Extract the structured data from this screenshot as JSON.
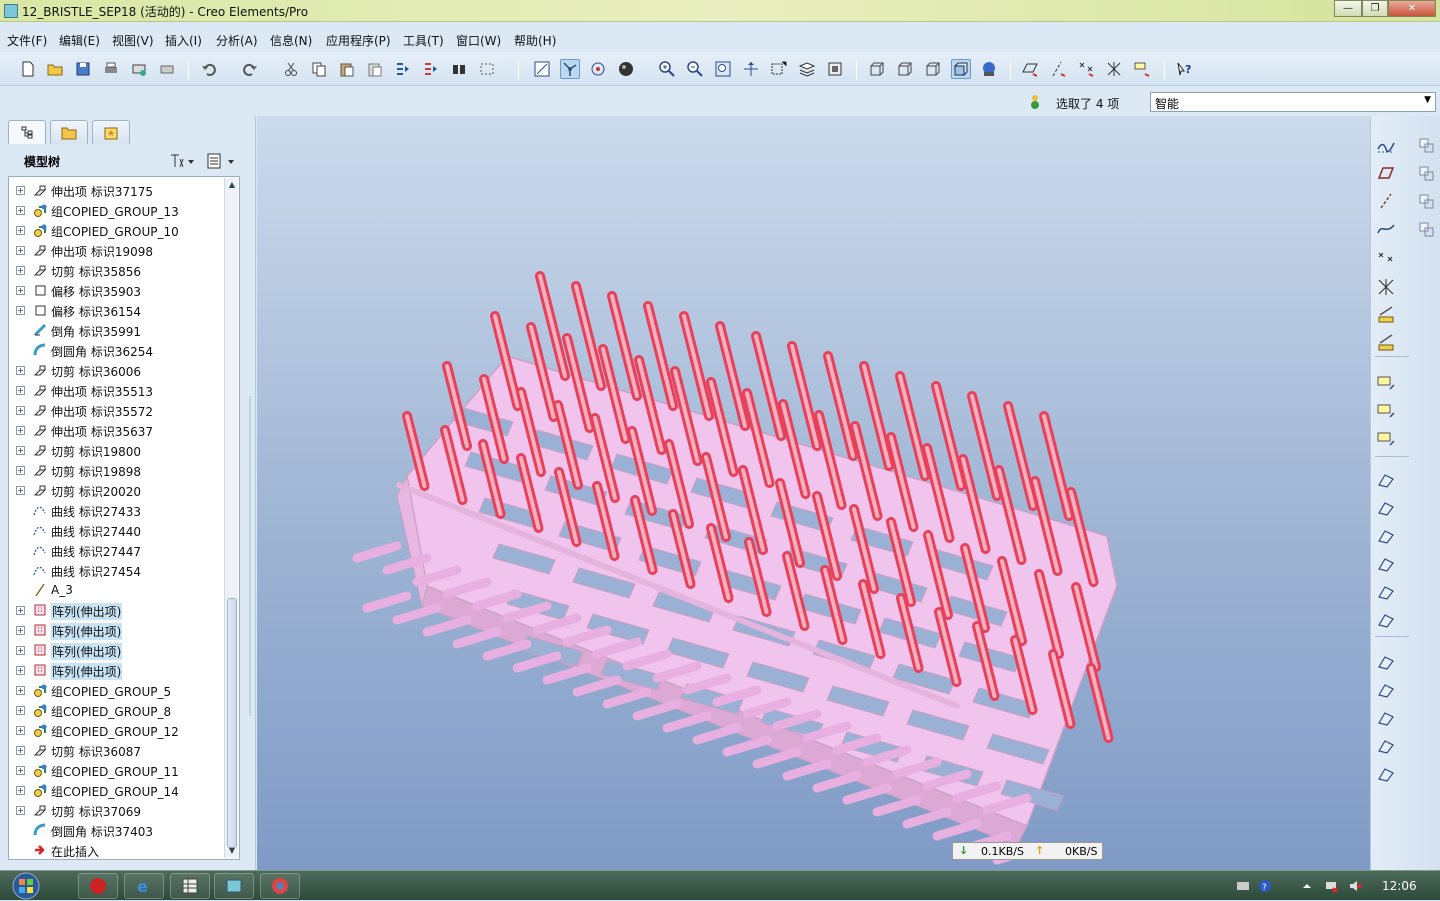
{
  "window": {
    "title": "12_BRISTLE_SEP18 (活动的) - Creo Elements/Pro",
    "min_label": "—",
    "max_label": "❐",
    "close_label": "✕"
  },
  "menu": [
    {
      "label": "文件(F)"
    },
    {
      "label": "编辑(E)"
    },
    {
      "label": "视图(V)"
    },
    {
      "label": "插入(I)"
    },
    {
      "label": "分析(A)"
    },
    {
      "label": "信息(N)"
    },
    {
      "label": "应用程序(P)"
    },
    {
      "label": "工具(T)"
    },
    {
      "label": "窗口(W)"
    },
    {
      "label": "帮助(H)"
    }
  ],
  "toolbar": {
    "icons": [
      "new-icon",
      "open-icon",
      "save-icon",
      "print-icon",
      "send-icon",
      "erase-icon",
      "undo-icon",
      "redo-icon",
      "cut-icon",
      "copy-icon",
      "paste-icon",
      "paste-special-icon",
      "regenerate-icon",
      "regen-manager-icon",
      "find-icon",
      "select-box-icon",
      "datum-display-icon",
      "spin-center-icon",
      "orient-icon",
      "shading-icon",
      "zoom-in-icon",
      "zoom-out-icon",
      "refit-icon",
      "reorient-icon",
      "view-manager-icon",
      "layers-icon",
      "appearance-icon",
      "wireframe-icon",
      "hidden-line-icon",
      "no-hidden-icon",
      "shaded-icon",
      "enhanced-realism-icon",
      "datum-planes-icon",
      "datum-axes-icon",
      "datum-points-icon",
      "coord-sys-icon",
      "annotation-icon",
      "help-whats-this-icon"
    ]
  },
  "selection": {
    "status": "选取了 4 项",
    "filter_value": "智能"
  },
  "left_panel": {
    "tree_title": "模型树",
    "items": [
      {
        "label": "伸出项 标识37175",
        "icon": "protrusion-icon",
        "expandable": true,
        "highlight": false
      },
      {
        "label": "组COPIED_GROUP_13",
        "icon": "group-icon",
        "expandable": true,
        "highlight": false
      },
      {
        "label": "组COPIED_GROUP_10",
        "icon": "group-icon",
        "expandable": true,
        "highlight": false
      },
      {
        "label": "伸出项 标识19098",
        "icon": "protrusion-icon",
        "expandable": true,
        "highlight": false
      },
      {
        "label": "切剪 标识35856",
        "icon": "cut-feature-icon",
        "expandable": true,
        "highlight": false
      },
      {
        "label": "偏移 标识35903",
        "icon": "offset-icon",
        "expandable": true,
        "highlight": false
      },
      {
        "label": "偏移 标识36154",
        "icon": "offset-icon",
        "expandable": true,
        "highlight": false
      },
      {
        "label": "倒角 标识35991",
        "icon": "chamfer-icon",
        "expandable": false,
        "highlight": false
      },
      {
        "label": "倒圆角 标识36254",
        "icon": "round-icon",
        "expandable": false,
        "highlight": false
      },
      {
        "label": "切剪 标识36006",
        "icon": "cut-feature-icon",
        "expandable": true,
        "highlight": false
      },
      {
        "label": "伸出项 标识35513",
        "icon": "protrusion-icon",
        "expandable": true,
        "highlight": false
      },
      {
        "label": "伸出项 标识35572",
        "icon": "protrusion-icon",
        "expandable": true,
        "highlight": false
      },
      {
        "label": "伸出项 标识35637",
        "icon": "protrusion-icon",
        "expandable": true,
        "highlight": false
      },
      {
        "label": "切剪 标识19800",
        "icon": "cut-feature-icon",
        "expandable": true,
        "highlight": false
      },
      {
        "label": "切剪 标识19898",
        "icon": "cut-feature-icon",
        "expandable": true,
        "highlight": false
      },
      {
        "label": "切剪 标识20020",
        "icon": "cut-feature-icon",
        "expandable": true,
        "highlight": false
      },
      {
        "label": "曲线 标识27433",
        "icon": "curve-icon",
        "expandable": false,
        "highlight": false
      },
      {
        "label": "曲线 标识27440",
        "icon": "curve-icon",
        "expandable": false,
        "highlight": false
      },
      {
        "label": "曲线 标识27447",
        "icon": "curve-icon",
        "expandable": false,
        "highlight": false
      },
      {
        "label": "曲线 标识27454",
        "icon": "curve-icon",
        "expandable": false,
        "highlight": false
      },
      {
        "label": "A_3",
        "icon": "axis-icon",
        "expandable": false,
        "highlight": false
      },
      {
        "label": "阵列(伸出项)",
        "icon": "pattern-icon",
        "expandable": true,
        "highlight": true
      },
      {
        "label": "阵列(伸出项)",
        "icon": "pattern-icon",
        "expandable": true,
        "highlight": true
      },
      {
        "label": "阵列(伸出项)",
        "icon": "pattern-icon",
        "expandable": true,
        "highlight": true
      },
      {
        "label": "阵列(伸出项)",
        "icon": "pattern-icon",
        "expandable": true,
        "highlight": true
      },
      {
        "label": "组COPIED_GROUP_5",
        "icon": "group-icon",
        "expandable": true,
        "highlight": false
      },
      {
        "label": "组COPIED_GROUP_8",
        "icon": "group-icon",
        "expandable": true,
        "highlight": false
      },
      {
        "label": "组COPIED_GROUP_12",
        "icon": "group-icon",
        "expandable": true,
        "highlight": false
      },
      {
        "label": "切剪 标识36087",
        "icon": "cut-feature-icon",
        "expandable": true,
        "highlight": false
      },
      {
        "label": "组COPIED_GROUP_11",
        "icon": "group-icon",
        "expandable": true,
        "highlight": false
      },
      {
        "label": "组COPIED_GROUP_14",
        "icon": "group-icon",
        "expandable": true,
        "highlight": false
      },
      {
        "label": "切剪 标识37069",
        "icon": "cut-feature-icon",
        "expandable": true,
        "highlight": false
      },
      {
        "label": "倒圆角 标识37403",
        "icon": "round-icon",
        "expandable": false,
        "highlight": false
      },
      {
        "label": "在此插入",
        "icon": "insert-here-icon",
        "expandable": false,
        "highlight": false
      }
    ]
  },
  "netmeter": {
    "down": "0.1KB/S",
    "up": "0KB/S"
  },
  "taskbar": {
    "clock": "12:06"
  },
  "colors": {
    "model_fill": "#f0c4ec",
    "selected_bristle": "#e8405a",
    "background_top": "#ccdaec",
    "background_bottom": "#7f9bc6"
  }
}
